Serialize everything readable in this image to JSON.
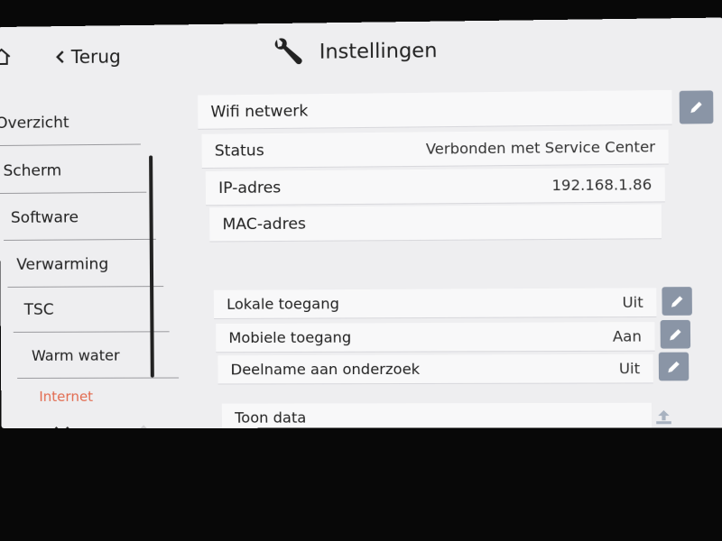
{
  "header": {
    "back_label": "Terug",
    "title": "Instellingen",
    "home_icon": "home-icon",
    "title_icon": "wrench-icon"
  },
  "sidebar": {
    "items": [
      {
        "label": "Overzicht",
        "active": false
      },
      {
        "label": "Scherm",
        "active": false
      },
      {
        "label": "Software",
        "active": false
      },
      {
        "label": "Verwarming",
        "active": false
      },
      {
        "label": "TSC",
        "active": false
      },
      {
        "label": "Warm water",
        "active": false
      },
      {
        "label": "Internet",
        "active": true
      }
    ],
    "active_color": "#e26a4e"
  },
  "network": {
    "wifi_label": "Wifi netwerk",
    "status_label": "Status",
    "status_value": "Verbonden met Service Center",
    "ip_label": "IP-adres",
    "ip_value": "192.168.1.86",
    "mac_label": "MAC-adres",
    "mac_value": ""
  },
  "access": {
    "local_label": "Lokale toegang",
    "local_value": "Uit",
    "mobile_label": "Mobiele toegang",
    "mobile_value": "Aan",
    "research_label": "Deelname aan onderzoek",
    "research_value": "Uit"
  },
  "data": {
    "show_label": "Toon data"
  },
  "colors": {
    "button_bg": "#8a95a6",
    "screen_bg": "#eeeef0",
    "row_bg": "#f8f8f9"
  }
}
